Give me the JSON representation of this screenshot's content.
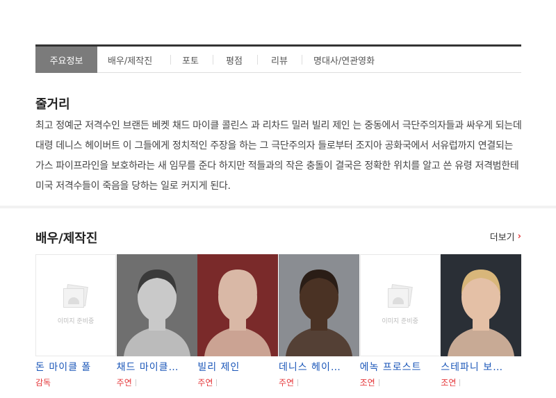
{
  "tabs": [
    {
      "label": "주요정보",
      "active": true
    },
    {
      "label": "배우/제작진"
    },
    {
      "label": "포토"
    },
    {
      "label": "평점"
    },
    {
      "label": "리뷰"
    },
    {
      "label": "명대사/연관영화"
    }
  ],
  "synopsis": {
    "title": "줄거리",
    "text": "최고 정예군 저격수인 브랜든 베켓 채드 마이클 콜린스 과 리차드 밀러 빌리 제인 는 중동에서 극단주의자들과 싸우게 되는데 대령 데니스 헤이버트 이 그들에게 정치적인 주장을 하는 그 극단주의자 들로부터 조지아 공화국에서 서유럽까지 연결되는 가스 파이프라인을 보호하라는 새 임무를 준다 하지만 적들과의 작은 충돌이 결국은 정확한 위치를 알고 쓴 유령 저격범한테 미국 저격수들이 죽음을 당하는 일로 커지게 된다."
  },
  "cast_section": {
    "title": "배우/제작진",
    "more_label": "더보기",
    "more_icon": "chevron-right-icon",
    "placeholder_text": "이미지 준비중",
    "members": [
      {
        "name": "돈 마이클 폴",
        "role": "감독",
        "photo": "placeholder"
      },
      {
        "name": "채드 마이클…",
        "role": "주연",
        "photo": "person",
        "bg": "#6f6f6f",
        "skin": "#c9c9c9",
        "hair": "#3a3a3a"
      },
      {
        "name": "빌리 제인",
        "role": "주연",
        "photo": "person",
        "bg": "#7a2a2a",
        "skin": "#d9b8a6",
        "hair": "#d9b8a6"
      },
      {
        "name": "데니스 헤이…",
        "role": "주연",
        "photo": "person",
        "bg": "#8a8d92",
        "skin": "#4a3224",
        "hair": "#2a1d16"
      },
      {
        "name": "에녹 프로스트",
        "role": "조연",
        "photo": "placeholder"
      },
      {
        "name": "스테파니 보…",
        "role": "조연",
        "photo": "person",
        "bg": "#2a2f36",
        "skin": "#e4c0a6",
        "hair": "#d8b67a"
      }
    ]
  }
}
